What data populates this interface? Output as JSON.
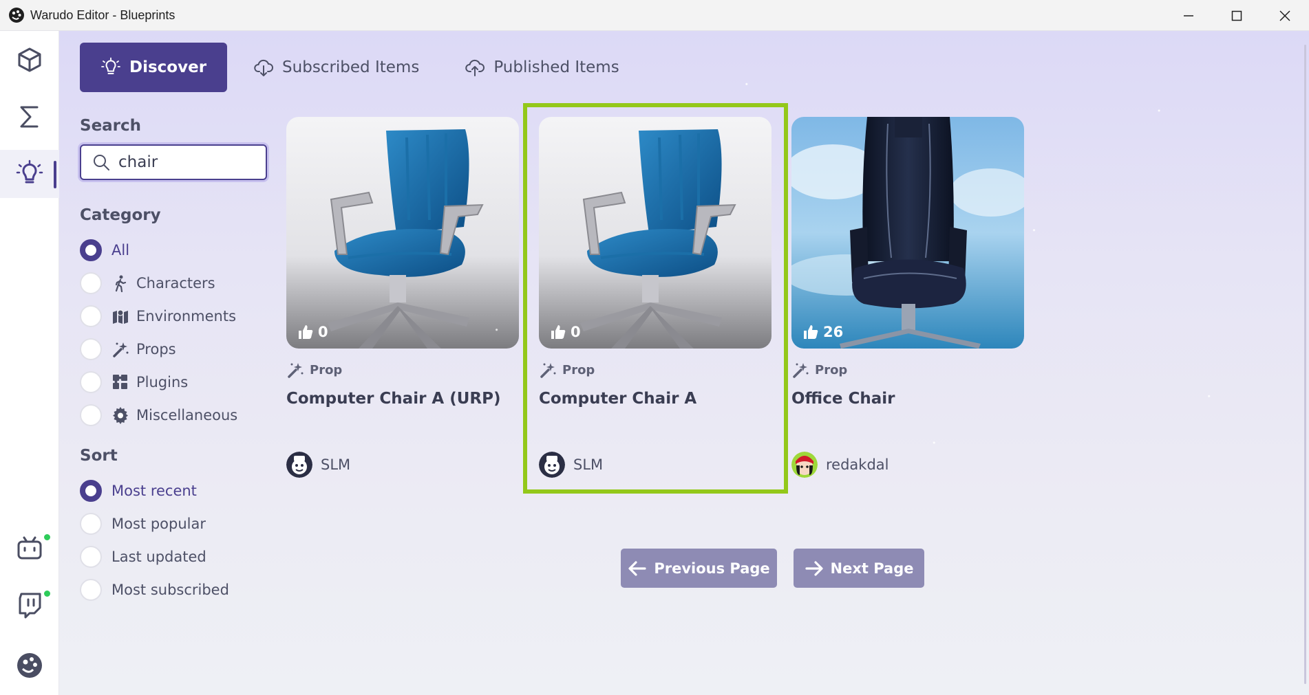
{
  "window": {
    "title": "Warudo Editor - Blueprints"
  },
  "tabs": [
    {
      "label": "Discover",
      "icon": "lightbulb-icon",
      "active": true
    },
    {
      "label": "Subscribed Items",
      "icon": "cloud-download-icon",
      "active": false
    },
    {
      "label": "Published Items",
      "icon": "cloud-upload-icon",
      "active": false
    }
  ],
  "search": {
    "title": "Search",
    "value": "chair"
  },
  "category": {
    "title": "Category",
    "options": [
      {
        "label": "All",
        "checked": true
      },
      {
        "label": "Characters",
        "icon": "person-walking-icon"
      },
      {
        "label": "Environments",
        "icon": "map-icon"
      },
      {
        "label": "Props",
        "icon": "magic-wand-icon"
      },
      {
        "label": "Plugins",
        "icon": "puzzle-icon"
      },
      {
        "label": "Miscellaneous",
        "icon": "gear-icon"
      }
    ]
  },
  "sort": {
    "title": "Sort",
    "options": [
      {
        "label": "Most recent",
        "checked": true
      },
      {
        "label": "Most popular"
      },
      {
        "label": "Last updated"
      },
      {
        "label": "Most subscribed"
      }
    ]
  },
  "cards": [
    {
      "likes": "0",
      "type": "Prop",
      "title": "Computer Chair A (URP)",
      "author": "SLM"
    },
    {
      "likes": "0",
      "type": "Prop",
      "title": "Computer Chair A",
      "author": "SLM",
      "highlighted": true
    },
    {
      "likes": "26",
      "type": "Prop",
      "title": "Office Chair",
      "author": "redakdal"
    }
  ],
  "pagination": {
    "previous_label": "Previous Page",
    "next_label": "Next Page"
  },
  "colors": {
    "accent": "#4a3f8e",
    "highlight": "#93c81a",
    "pager": "#8e8bb4",
    "status_online": "#2ecc5a"
  }
}
